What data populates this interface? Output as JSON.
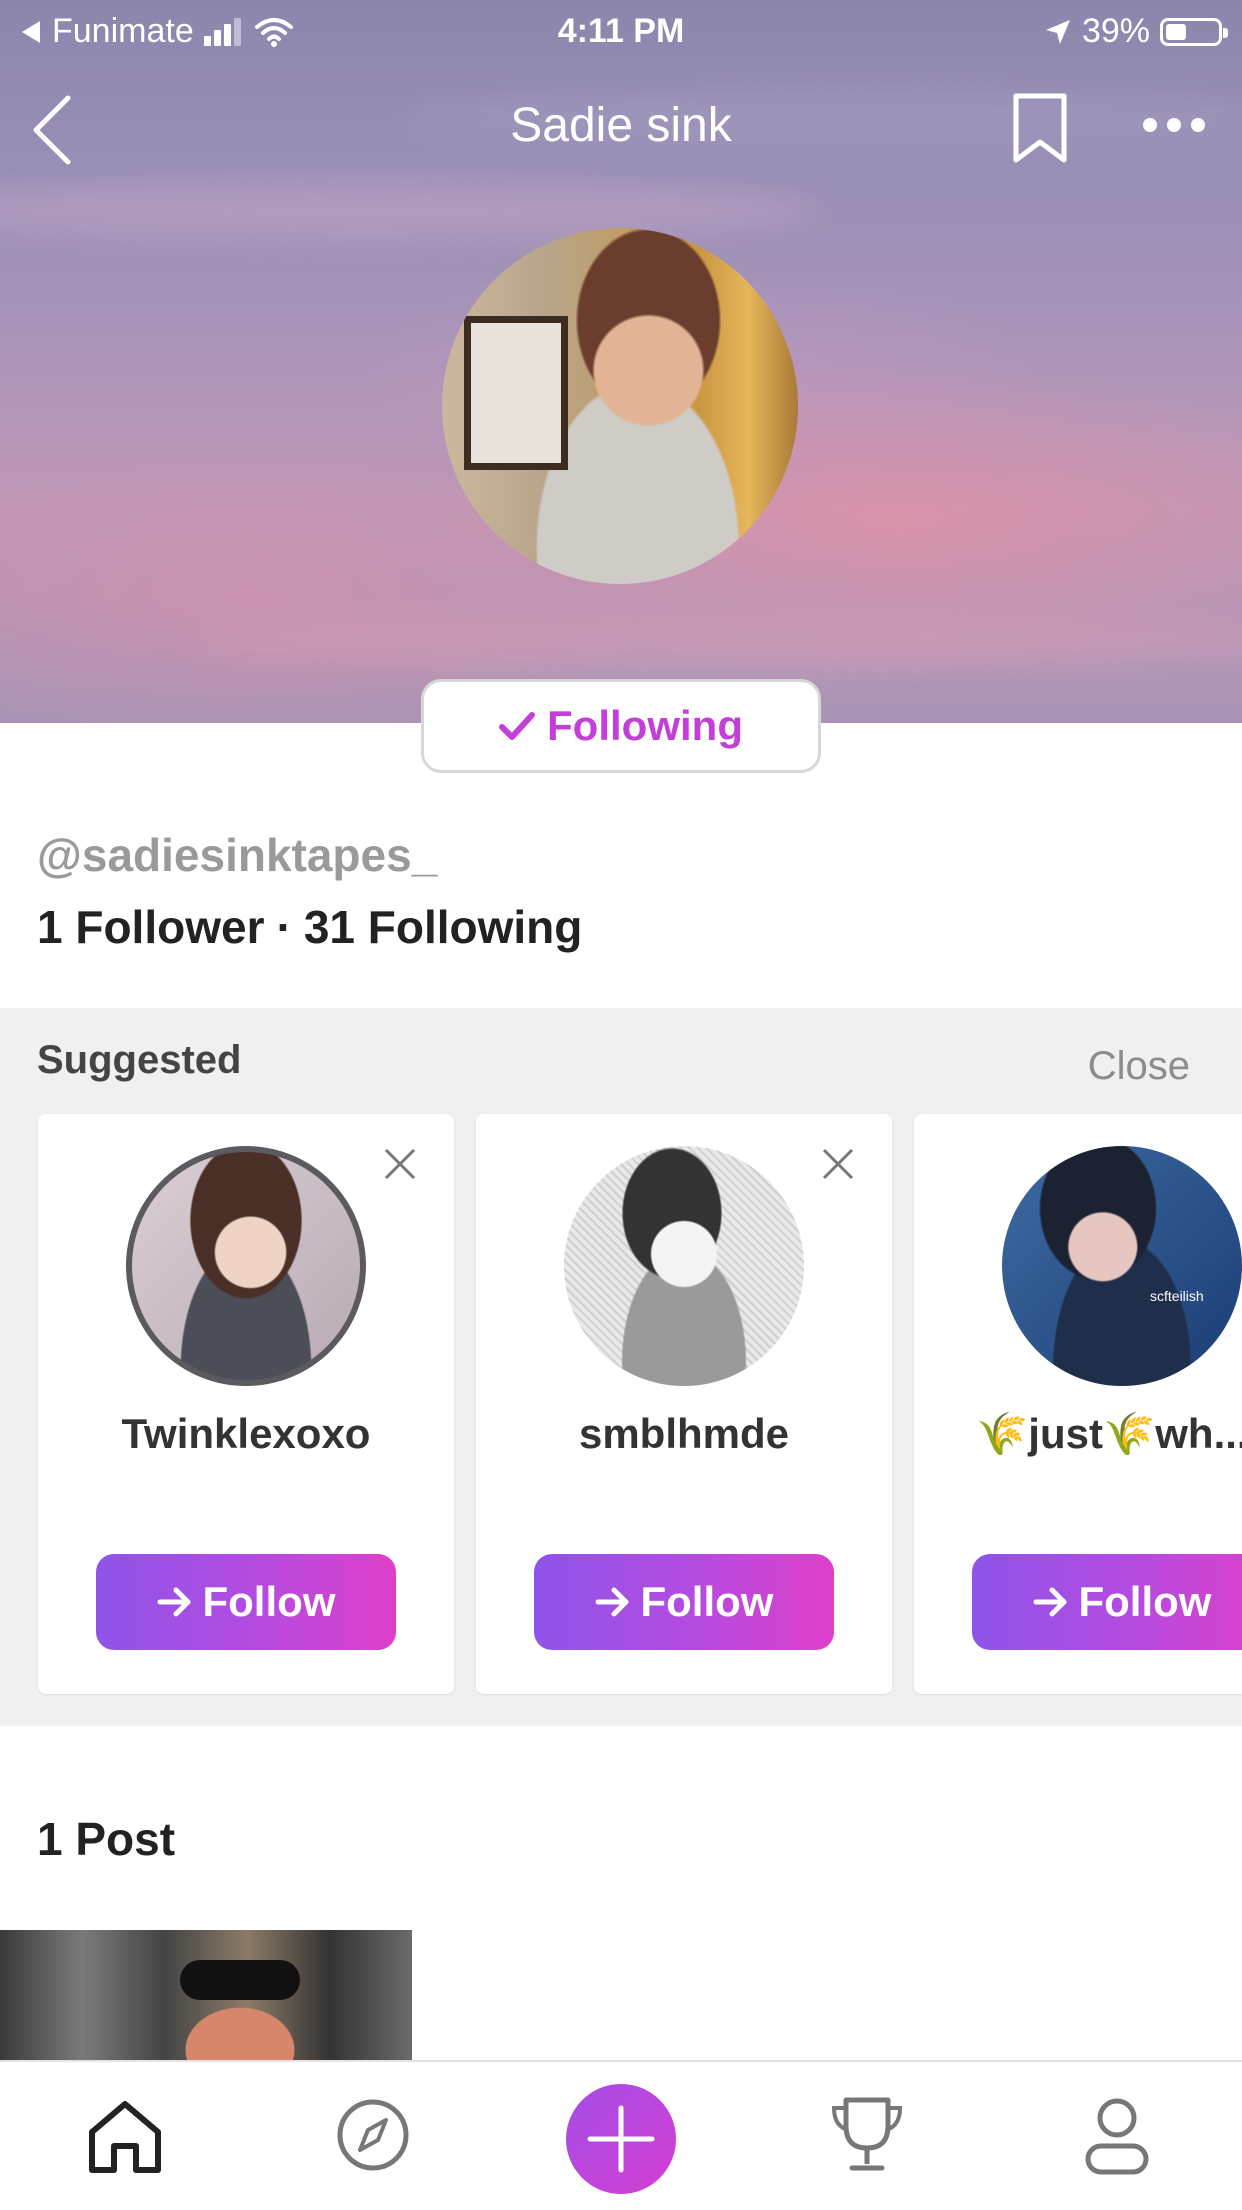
{
  "status_bar": {
    "carrier": "Funimate",
    "time": "4:11 PM",
    "battery_percent": "39%",
    "battery_level": 0.39
  },
  "nav": {
    "title": "Sadie sink",
    "back_icon": "chevron-left-icon",
    "bookmark_icon": "bookmark-icon",
    "more_icon": "more-horizontal-icon"
  },
  "profile": {
    "following_label": "Following",
    "handle": "@sadiesinktapes_",
    "followers": "1 Follower",
    "separator": "·",
    "following_count": "31 Following"
  },
  "suggested": {
    "title": "Suggested",
    "close_label": "Close",
    "cards": [
      {
        "name": "Twinklexoxo",
        "follow_label": "Follow"
      },
      {
        "name": "smblhmde",
        "follow_label": "Follow"
      },
      {
        "name": "🌾just🌾wh...",
        "follow_label": "Follow",
        "avatar_overlay_text": "scfteilish"
      }
    ]
  },
  "posts": {
    "title": "1 Post"
  },
  "tabbar": {
    "items": [
      "home-icon",
      "explore-icon",
      "create-icon",
      "trophy-icon",
      "profile-icon"
    ]
  },
  "colors": {
    "accent": "#c43fd9",
    "gradient_start": "#8e54e9",
    "gradient_end": "#de3fc9"
  }
}
